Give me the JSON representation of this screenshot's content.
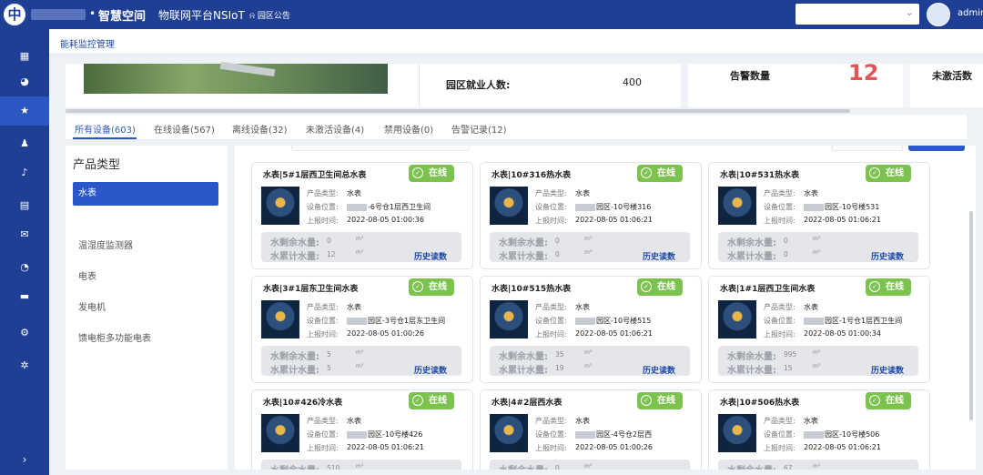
{
  "topbar": {
    "logo": "中",
    "dot": "•",
    "brand": "智慧空间",
    "platform": "物联网平台NSIoT",
    "notice_icon": "bell-icon",
    "notice": "园区公告",
    "select_value": "",
    "user": "admin",
    "background": "#1f3f94"
  },
  "sidebar": {
    "icons": [
      "grid-icon",
      "pie-chart-icon",
      "star-icon",
      "user-icon",
      "bell-icon",
      "document-icon",
      "mail-icon",
      "chart-icon",
      "folder-icon",
      "gear-icon",
      "settings-icon"
    ],
    "active_index": 2,
    "collapse_icon": "chevron-right-icon"
  },
  "breadcrumb": "能耗监控管理",
  "stats": {
    "employment_label": "园区就业人数:",
    "employment_value": "400",
    "alarm_label": "告警数量",
    "alarm_value": "12",
    "inactive_label": "未激活数"
  },
  "tabs": [
    "所有设备(603)",
    "在线设备(567)",
    "离线设备(32)",
    "未激活设备(4)",
    "禁用设备(0)",
    "告警记录(12)"
  ],
  "active_tab": 0,
  "categories": {
    "title": "产品类型",
    "items": [
      "水表",
      "温湿度监测器",
      "电表",
      "发电机",
      "馈电柜多功能电表"
    ],
    "active_index": 0
  },
  "cards": [
    {
      "title": "水表|5#1层西卫生间总水表",
      "status": "在线",
      "type": "水表",
      "location": "-6号仓1层西卫生间",
      "time": "2022-08-05 01:00:36",
      "remain": "0",
      "total": "12",
      "unit": "m³",
      "history": "历史读数"
    },
    {
      "title": "水表|10#316热水表",
      "status": "在线",
      "type": "水表",
      "location": "园区-10号楼316",
      "time": "2022-08-05 01:06:21",
      "remain": "0",
      "total": "0",
      "unit": "m³",
      "history": "历史读数"
    },
    {
      "title": "水表|10#531热水表",
      "status": "在线",
      "type": "水表",
      "location": "园区-10号楼531",
      "time": "2022-08-05 01:06:21",
      "remain": "0",
      "total": "0",
      "unit": "m³",
      "history": "历史读数"
    },
    {
      "title": "水表|3#1层东卫生间水表",
      "status": "在线",
      "type": "水表",
      "location": "园区-3号仓1层东卫生间",
      "time": "2022-08-05 01:00:26",
      "remain": "5",
      "total": "5",
      "unit": "m³",
      "history": "历史读数"
    },
    {
      "title": "水表|10#515热水表",
      "status": "在线",
      "type": "水表",
      "location": "园区-10号楼515",
      "time": "2022-08-05 01:06:21",
      "remain": "35",
      "total": "19",
      "unit": "m³",
      "history": "历史读数"
    },
    {
      "title": "水表|1#1层西卫生间水表",
      "status": "在线",
      "type": "水表",
      "location": "园区-1号仓1层西卫生间",
      "time": "2022-08-05 01:00:34",
      "remain": "995",
      "total": "15",
      "unit": "m³",
      "history": "历史读数"
    },
    {
      "title": "水表|10#426冷水表",
      "status": "在线",
      "type": "水表",
      "location": "园区-10号楼426",
      "time": "2022-08-05 01:06:21",
      "remain": "510",
      "total": "",
      "unit": "m³",
      "history": ""
    },
    {
      "title": "水表|4#2层西水表",
      "status": "在线",
      "type": "水表",
      "location": "园区-4号仓2层西",
      "time": "2022-08-05 01:00:26",
      "remain": "0",
      "total": "",
      "unit": "m³",
      "history": ""
    },
    {
      "title": "水表|10#506热水表",
      "status": "在线",
      "type": "水表",
      "location": "园区-10号楼506",
      "time": "2022-08-05 01:06:21",
      "remain": "67",
      "total": "",
      "unit": "m³",
      "history": ""
    }
  ],
  "card_labels": {
    "type": "产品类型:",
    "location": "设备位置:",
    "time": "上报时间:",
    "remain": "水剩余水量:",
    "total": "水累计水量:"
  },
  "colors": {
    "accent": "#2b58c8",
    "online": "#7cc24e",
    "alarm": "#e05656"
  }
}
